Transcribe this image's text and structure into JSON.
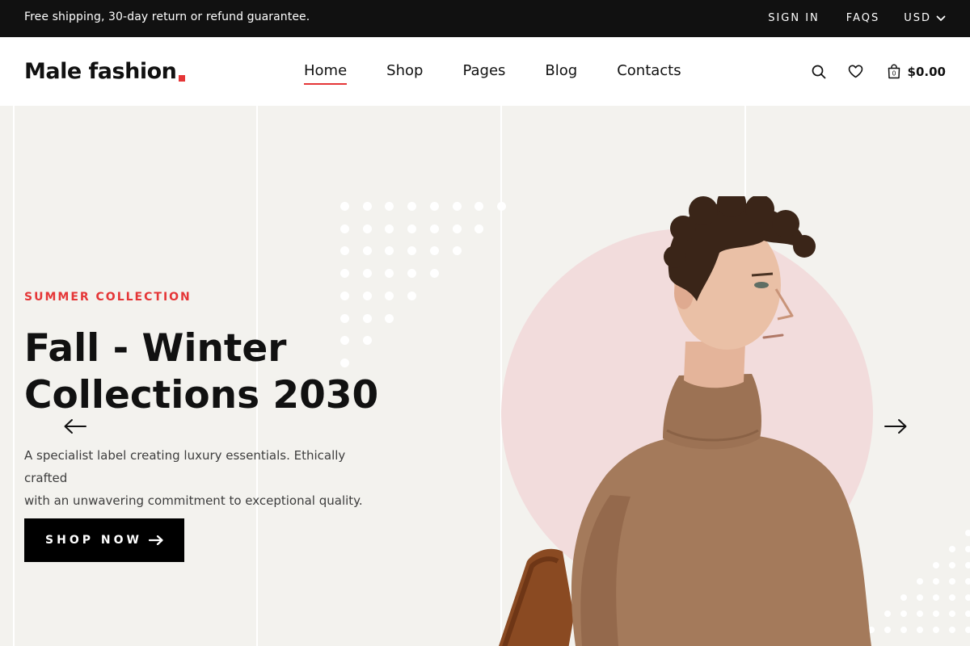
{
  "topbar": {
    "notice": "Free shipping, 30-day return or refund guarantee.",
    "sign_in": "SIGN IN",
    "faqs": "FAQS",
    "currency": "USD"
  },
  "header": {
    "logo_text": "Male fashion",
    "nav": [
      "Home",
      "Shop",
      "Pages",
      "Blog",
      "Contacts"
    ],
    "active_nav": "Home",
    "cart_price": "$0.00",
    "cart_count": "0"
  },
  "hero": {
    "subtitle": "SUMMER COLLECTION",
    "title_line1": "Fall - Winter",
    "title_line2": "Collections 2030",
    "description_line1": "A specialist label creating luxury essentials. Ethically crafted",
    "description_line2": "with an unwavering commitment to exceptional quality.",
    "button_label": "SHOP NOW"
  },
  "icons": {
    "search": "search-icon",
    "heart": "heart-icon",
    "cart": "shopping-bag-icon",
    "chevron": "chevron-down-icon",
    "arrow_left": "arrow-left-icon",
    "arrow_right": "arrow-right-icon"
  },
  "colors": {
    "accent": "#e53637",
    "topbar_bg": "#111111",
    "hero_bg": "#f3f2ee",
    "circle": "#f2dcdc",
    "sweater": "#a47a5b",
    "button_bg": "#000000"
  }
}
